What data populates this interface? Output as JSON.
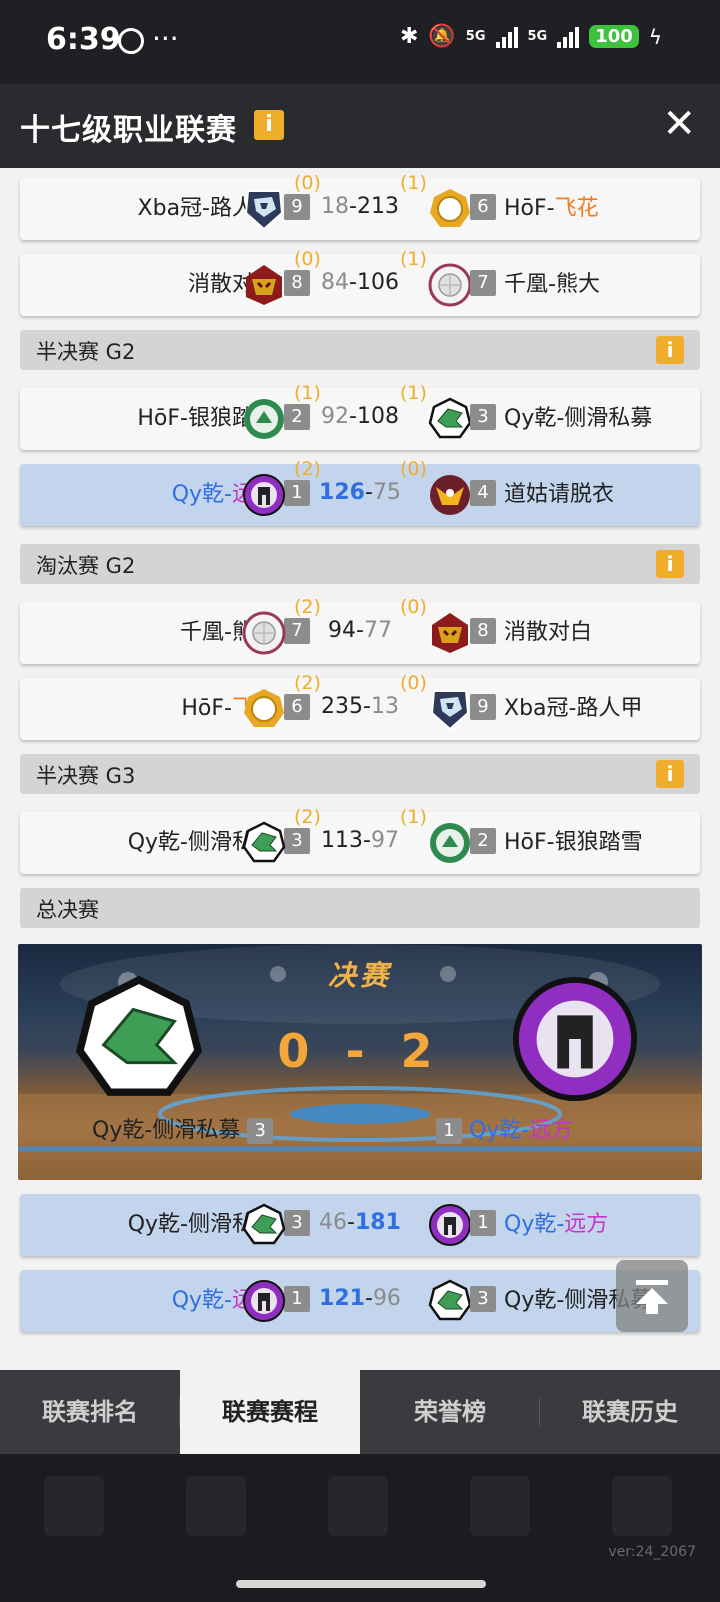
{
  "status_bar": {
    "time": "6:39",
    "dots": "···",
    "signal1": "5G",
    "signal2": "5G",
    "battery": "100"
  },
  "header": {
    "title": "十七级职业联赛",
    "info_icon": "i",
    "close_icon": "✕"
  },
  "colors": {
    "accent_gold": "#f0ac2b",
    "highlight_row": "#c2d5ec",
    "winner_blue": "#2f6fe0",
    "name_purple": "#c733c7",
    "name_orange": "#f47b20"
  },
  "matches_top": [
    {
      "left": {
        "prefix": "Xba冠-路人甲",
        "accent": "",
        "seed": "9"
      },
      "left_wins": "(0)",
      "score_l": "18",
      "dash": "-",
      "score_r": "213",
      "right_wins": "(1)",
      "right": {
        "prefix": "HōF-",
        "accent": "飞花",
        "seed": "6"
      }
    },
    {
      "left": {
        "prefix": "消散对白",
        "accent": "",
        "seed": "8"
      },
      "left_wins": "(0)",
      "score_l": "84",
      "dash": "-",
      "score_r": "106",
      "right_wins": "(1)",
      "right": {
        "prefix": "千凰-熊大",
        "accent": "",
        "seed": "7"
      }
    }
  ],
  "sections": {
    "semi_g2": "半决赛 G2",
    "elim_g2": "淘汰赛 G2",
    "semi_g3": "半决赛 G3",
    "final": "总决赛"
  },
  "semi_g2_matches": [
    {
      "left": {
        "prefix": "HōF-银狼踏雪",
        "seed": "2"
      },
      "left_wins": "(1)",
      "score_l": "92",
      "dash": "-",
      "score_r": "108",
      "right_wins": "(1)",
      "right": {
        "prefix": "Qy乾-侧滑私募",
        "seed": "3"
      }
    },
    {
      "left": {
        "prefix": "Qy乾-",
        "accent": "远方",
        "seed": "1"
      },
      "left_wins": "(2)",
      "score_l": "126",
      "dash": "-",
      "score_r": "75",
      "right_wins": "(0)",
      "right": {
        "prefix": "道姑请脱衣",
        "seed": "4"
      }
    }
  ],
  "elim_g2_matches": [
    {
      "left": {
        "prefix": "千凰-熊大",
        "seed": "7"
      },
      "left_wins": "(2)",
      "score_l": "94",
      "dash": "-",
      "score_r": "77",
      "right_wins": "(0)",
      "right": {
        "prefix": "消散对白",
        "seed": "8"
      }
    },
    {
      "left": {
        "prefix": "HōF-",
        "accent": "飞花",
        "seed": "6"
      },
      "left_wins": "(2)",
      "score_l": "235",
      "dash": "-",
      "score_r": "13",
      "right_wins": "(0)",
      "right": {
        "prefix": "Xba冠-路人甲",
        "seed": "9"
      }
    }
  ],
  "semi_g3_matches": [
    {
      "left": {
        "prefix": "Qy乾-侧滑私募",
        "seed": "3"
      },
      "left_wins": "(2)",
      "score_l": "113",
      "dash": "-",
      "score_r": "97",
      "right_wins": "(1)",
      "right": {
        "prefix": "HōF-银狼踏雪",
        "seed": "2"
      }
    }
  ],
  "final_banner": {
    "title": "决赛",
    "score": "0 - 2",
    "left_name": "Qy乾-侧滑私募",
    "left_seed": "3",
    "right_seed": "1",
    "right_prefix": "Qy乾-",
    "right_accent": "远方"
  },
  "final_matches": [
    {
      "left": {
        "prefix": "Qy乾-侧滑私募",
        "seed": "3"
      },
      "score_l": "46",
      "dash": "-",
      "score_r": "181",
      "right": {
        "prefix": "Qy乾-",
        "accent": "远方",
        "seed": "1"
      }
    },
    {
      "left": {
        "prefix": "Qy乾-",
        "accent": "远方",
        "seed": "1"
      },
      "score_l": "121",
      "dash": "-",
      "score_r": "96",
      "right": {
        "prefix": "Qy乾-侧滑私募",
        "seed": "3"
      }
    }
  ],
  "tabs": [
    "联赛排名",
    "联赛赛程",
    "荣誉榜",
    "联赛历史"
  ],
  "active_tab": 1,
  "version": "ver:24_2067",
  "icons": {
    "back_to_top": "arrow-up-to-top-icon",
    "team_logos": [
      "wolf-shield-icon",
      "gold-ring-icon",
      "red-demon-icon",
      "silver-ball-icon",
      "green-wolf-icon",
      "green-dragon-icon",
      "purple-spartan-icon",
      "golden-bird-icon"
    ]
  }
}
